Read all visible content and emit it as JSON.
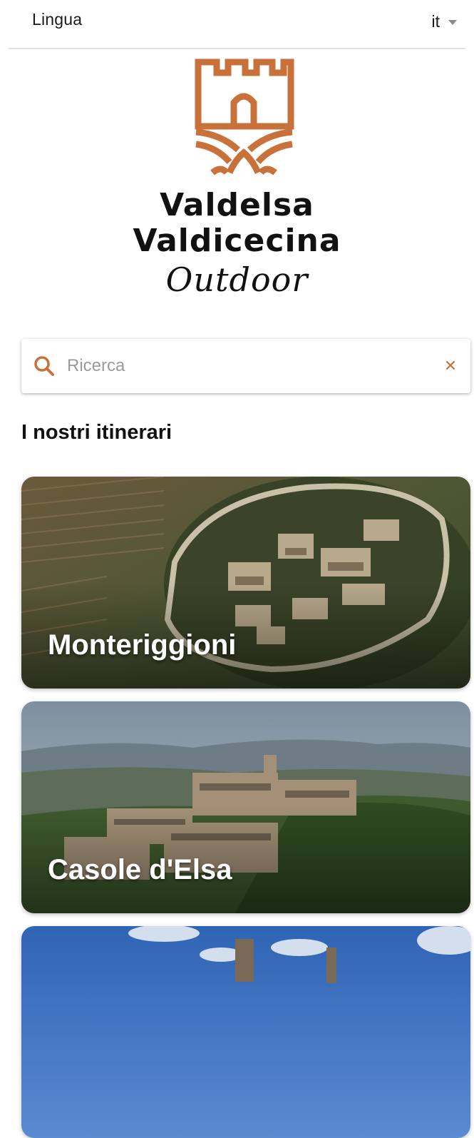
{
  "language_bar": {
    "label": "Lingua",
    "selected": "it"
  },
  "logo": {
    "line1": "Valdelsa",
    "line2": "Valdicecina",
    "line3": "Outdoor",
    "color": "#c8713a"
  },
  "search": {
    "placeholder": "Ricerca",
    "value": "",
    "clear_icon": "close-icon",
    "icon": "search-icon"
  },
  "section": {
    "title": "I nostri itinerari"
  },
  "itineraries": [
    {
      "title": "Monteriggioni"
    },
    {
      "title": "Casole d'Elsa"
    },
    {
      "title": ""
    }
  ],
  "colors": {
    "accent": "#c8713a",
    "text": "#111111"
  }
}
